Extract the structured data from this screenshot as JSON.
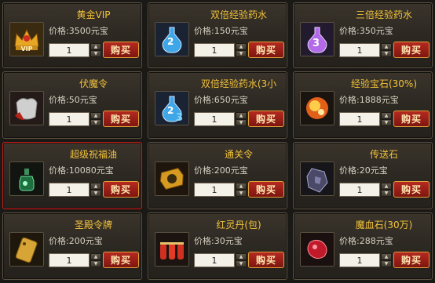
{
  "items": [
    {
      "name": "黄金VIP",
      "price": "3500元宝",
      "qty": "1",
      "buy": "购买",
      "icon": "golden-crown-icon",
      "icon_text": "VIP"
    },
    {
      "name": "双倍经验药水",
      "price": "150元宝",
      "qty": "1",
      "buy": "购买",
      "icon": "double-exp-potion-icon",
      "icon_text": "2"
    },
    {
      "name": "三倍经验药水",
      "price": "350元宝",
      "qty": "1",
      "buy": "购买",
      "icon": "triple-exp-potion-icon",
      "icon_text": "3"
    },
    {
      "name": "伏魔令",
      "price": "50元宝",
      "qty": "1",
      "buy": "购买",
      "icon": "demon-token-bag-icon"
    },
    {
      "name": "双倍经验药水(3小",
      "price": "650元宝",
      "qty": "1",
      "buy": "购买",
      "icon": "double-exp-potion-3h-icon",
      "icon_text": "3"
    },
    {
      "name": "经验宝石(30%)",
      "price": "1888元宝",
      "qty": "1",
      "buy": "购买",
      "icon": "exp-gem-icon"
    },
    {
      "name": "超级祝福油",
      "price": "10080元宝",
      "qty": "1",
      "buy": "购买",
      "icon": "blessing-oil-bottle-icon",
      "selected": true
    },
    {
      "name": "通关令",
      "price": "200元宝",
      "qty": "1",
      "buy": "购买",
      "icon": "clearance-token-icon"
    },
    {
      "name": "传送石",
      "price": "20元宝",
      "qty": "1",
      "buy": "购买",
      "icon": "teleport-stone-icon"
    },
    {
      "name": "圣殿令牌",
      "price": "200元宝",
      "qty": "1",
      "buy": "购买",
      "icon": "temple-token-icon"
    },
    {
      "name": "红灵丹(包)",
      "price": "30元宝",
      "qty": "1",
      "buy": "购买",
      "icon": "red-pills-icon"
    },
    {
      "name": "魔血石(30万)",
      "price": "288元宝",
      "qty": "1",
      "buy": "购买",
      "icon": "blood-stone-icon"
    }
  ],
  "labels": {
    "price_prefix": "价格:"
  },
  "colors": {
    "name_gold": "#f2c23b",
    "buy_red": "#b52a20",
    "selected_border": "#c1211c"
  }
}
